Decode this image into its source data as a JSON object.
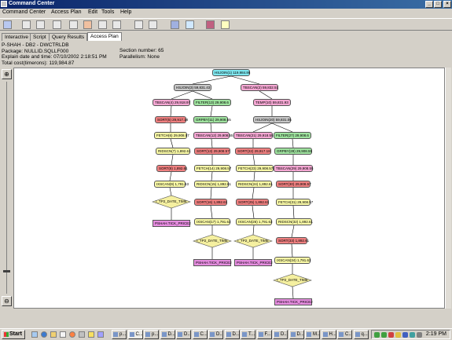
{
  "window": {
    "title": "Command Center"
  },
  "menu": [
    "Command Center",
    "Access Plan",
    "Edit",
    "Tools",
    "Help"
  ],
  "tabs": [
    {
      "label": "Interactive",
      "active": false
    },
    {
      "label": "Script",
      "active": false
    },
    {
      "label": "Query Results",
      "active": false
    },
    {
      "label": "Access Plan",
      "active": true
    }
  ],
  "info": {
    "line1": "P-SHAH - DB2 - DWCTRLDB",
    "line2": "Package: NULLID.SQLLF000",
    "line3": "Explain date and time: 07/10/2002 2:18:51 PM",
    "line4": "Total cost(timerons): 119,984.87",
    "section": "Section number: 65",
    "parallelism": "Parallelism: None"
  },
  "plan_nodes": [
    {
      "label": "HSJOIN(1) 119,984.86",
      "color": "cyan"
    },
    {
      "label": "HSJOIN(3) 59,831.43",
      "color": "grey"
    },
    {
      "label": "TBSCAN(2) 59,832.51",
      "color": "pink"
    },
    {
      "label": "TBSCAN(4) 29,918.97",
      "color": "pink"
    },
    {
      "label": "FILTER(13) 29,908.6",
      "color": "green"
    },
    {
      "label": "TEMP(10) 59,831.93",
      "color": "pink"
    },
    {
      "label": "SORT(5) 29,917.18",
      "color": "red"
    },
    {
      "label": "GRPBY(11) 29,908.55",
      "color": "green"
    },
    {
      "label": "HSJOIN(20) 59,831.05",
      "color": "grey"
    },
    {
      "label": "FETCH(6) 29,908.57",
      "color": "yellow"
    },
    {
      "label": "TBSCAN(12) 29,908.55",
      "color": "pink"
    },
    {
      "label": "TBSCAN(21) 29,918.55",
      "color": "pink"
    },
    {
      "label": "FILTER(27) 29,908.6",
      "color": "green"
    },
    {
      "label": "RIDSCN(7) 1,892.61",
      "color": "yellow"
    },
    {
      "label": "SORT(13) 29,908.57",
      "color": "red"
    },
    {
      "label": "SORT(22) 29,917.18",
      "color": "red"
    },
    {
      "label": "GRPBY(28) 29,908.55",
      "color": "green"
    },
    {
      "label": "SORT(8) 1,892.61",
      "color": "red"
    },
    {
      "label": "FETCH(14) 29,908.57",
      "color": "yellow"
    },
    {
      "label": "FETCH(23) 29,908.57",
      "color": "yellow"
    },
    {
      "label": "TBSCAN(29) 29,908.55",
      "color": "pink"
    },
    {
      "label": "IXSCAN(9) 1,791.63",
      "color": "yellow"
    },
    {
      "label": "RIDSCN(15) 1,892.61",
      "color": "yellow"
    },
    {
      "label": "RIDSCN(24) 1,892.61",
      "color": "yellow"
    },
    {
      "label": "SORT(30) 29,908.57",
      "color": "red"
    },
    {
      "label": "SORT(16) 1,892.61",
      "color": "red"
    },
    {
      "label": "SORT(25) 1,892.61",
      "color": "red"
    },
    {
      "label": "FETCH(31) 29,908.57",
      "color": "yellow"
    },
    {
      "label": "IXSCAN(17) 1,791.63",
      "color": "yellow"
    },
    {
      "label": "IXSCAN(26) 1,791.63",
      "color": "yellow"
    },
    {
      "label": "RIDSCN(32) 1,892.61",
      "color": "yellow"
    },
    {
      "label": "SORT(33) 1,892.61",
      "color": "red"
    },
    {
      "label": "IXSCAN(34) 1,791.63",
      "color": "yellow"
    }
  ],
  "index_nodes": [
    "I_TP2_DATE_TIME",
    "I_TP2_DATE_TIME",
    "I_TP2_DATE_TIME",
    "I_TP2_DATE_TIME"
  ],
  "table_nodes": [
    "PSHAH.TICK_PRICE2",
    "PSHAH.TICK_PRICE2",
    "PSHAH.TICK_PRICE2",
    "PSHAH.TICK_PRICE2"
  ],
  "colors": {
    "cyan": "#7fe8f0",
    "grey": "#c8c8c8",
    "pink": "#f5a7d3",
    "green": "#9fe39f",
    "red": "#f08080",
    "yellow": "#fafaa6",
    "table": "#e68de0",
    "diamond": "#f5f0a0"
  },
  "taskbar": {
    "start": "Start",
    "tasks": [
      "p...",
      "C...",
      "p...",
      "D...",
      "D...",
      "C...",
      "D...",
      "D...",
      "T...",
      "F...",
      "D...",
      "D...",
      "M...",
      "H...",
      "C...",
      "q..."
    ],
    "clock": "2:19 PM"
  }
}
